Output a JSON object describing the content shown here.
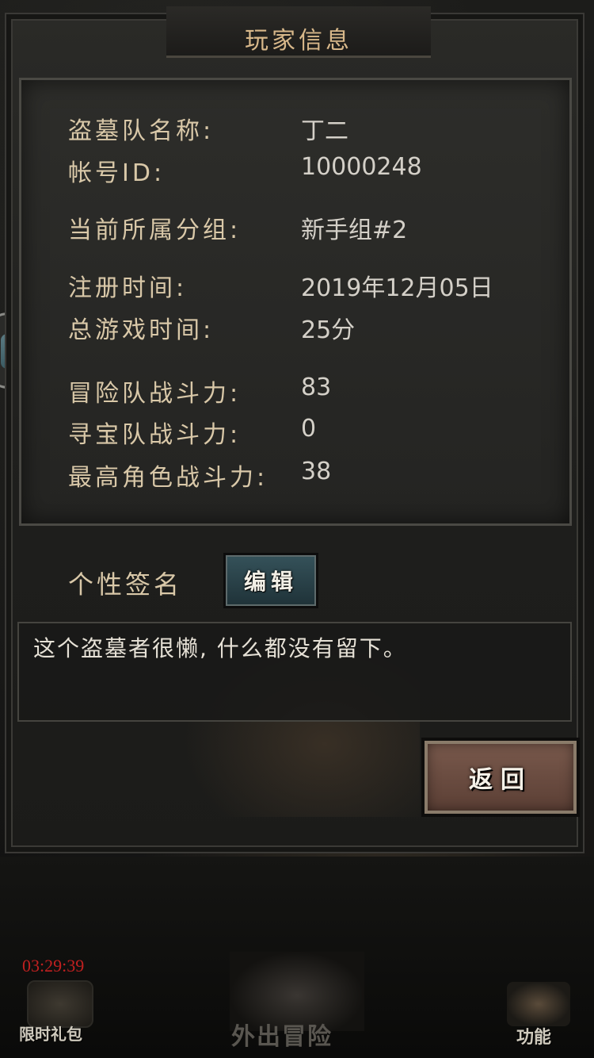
{
  "title": "玩家信息",
  "info": {
    "team_name_label": "盗墓队名称:",
    "team_name_value": "丁二",
    "account_id_label": "帐号ID:",
    "account_id_value": "10000248",
    "group_label": "当前所属分组:",
    "group_value": "新手组#2",
    "register_time_label": "注册时间:",
    "register_time_value": "2019年12月05日",
    "play_time_label": "总游戏时间:",
    "play_time_value": "25分",
    "adventure_power_label": "冒险队战斗力:",
    "adventure_power_value": "83",
    "treasure_power_label": "寻宝队战斗力:",
    "treasure_power_value": "0",
    "max_char_power_label": "最高角色战斗力:",
    "max_char_power_value": "38"
  },
  "signature": {
    "label": "个性签名",
    "edit_button": "编辑",
    "text": "这个盗墓者很懒, 什么都没有留下。"
  },
  "back_button": "返回",
  "bottom_nav": {
    "timer": "03:29:39",
    "gift_label": "限时礼包",
    "adventure_label": "外出冒险",
    "function_label": "功能"
  },
  "floating_button_icon": "app-bubble-icon"
}
